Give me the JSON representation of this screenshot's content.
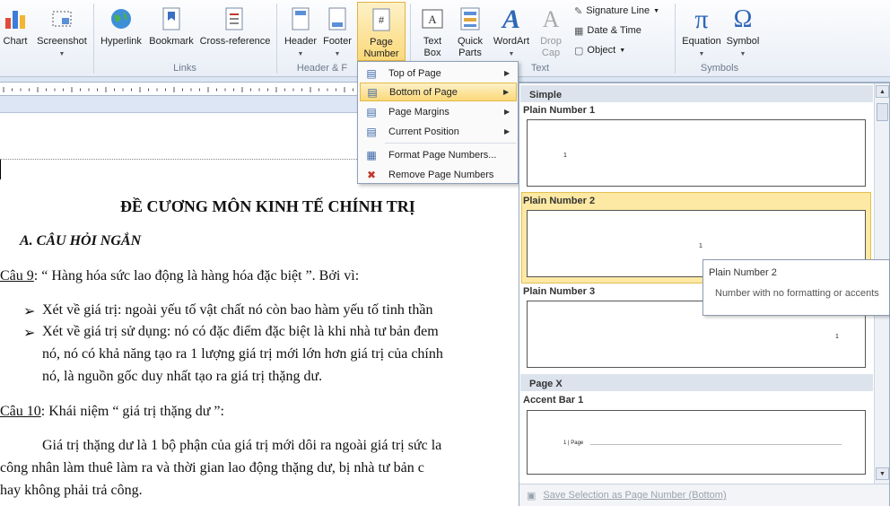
{
  "ribbon": {
    "chart": "Chart",
    "screenshot": "Screenshot",
    "hyperlink": "Hyperlink",
    "bookmark": "Bookmark",
    "crossref": "Cross-reference",
    "header": "Header",
    "footer": "Footer",
    "page_number_1": "Page",
    "page_number_2": "Number",
    "textbox_1": "Text",
    "textbox_2": "Box",
    "quickparts_1": "Quick",
    "quickparts_2": "Parts",
    "wordart": "WordArt",
    "dropcap_1": "Drop",
    "dropcap_2": "Cap",
    "signature": "Signature Line",
    "datetime": "Date & Time",
    "object": "Object",
    "equation": "Equation",
    "symbol": "Symbol",
    "group_links": "Links",
    "group_header": "Header & F",
    "group_text": "Text",
    "group_symbols": "Symbols"
  },
  "menu": {
    "items": [
      "Top of Page",
      "Bottom of Page",
      "Page Margins",
      "Current Position",
      "Format Page Numbers...",
      "Remove Page Numbers"
    ]
  },
  "gallery": {
    "section_simple": "Simple",
    "plain1": "Plain Number 1",
    "plain2": "Plain Number 2",
    "plain3": "Plain Number 3",
    "section_pagex": "Page X",
    "accent1": "Accent Bar 1",
    "thumb_num": "1",
    "accent_text": "1 | Page",
    "footer": "Save Selection as Page Number (Bottom)"
  },
  "tooltip": {
    "title": "Plain Number 2",
    "desc": "Number with no formatting or accents"
  },
  "doc": {
    "title": "ĐỀ CƯƠNG MÔN KINH TẾ CHÍNH TRỊ",
    "section": "A. CÂU HỎI NGẮN",
    "q9_label": "Câu 9",
    "q9_text": ": “ Hàng hóa sức lao động là hàng hóa đặc biệt ”. Bởi vì:",
    "b1": "Xét về giá trị: ngoài yếu tố vật chất nó còn bao hàm yếu tố tinh thần",
    "b2a": "Xét về giá trị sử dụng: nó có đặc điểm đặc biệt là khi nhà tư bản đem",
    "b2b": "nó, nó có khả năng tạo ra 1 lượng giá trị mới lớn hơn giá trị của chính",
    "b2c": "nó, là nguồn gốc duy nhất tạo ra giá trị thặng dư.",
    "q10_label": "Câu 10",
    "q10_text": ": Khái niệm “ giá trị thặng dư ”:",
    "p1": "Giá trị thặng dư là 1 bộ phận của giá trị mới dôi ra ngoài giá trị sức la",
    "p2": "công nhân làm thuê làm ra và thời gian lao động thặng dư, bị nhà tư bản c",
    "p3": "hay không phải trả công."
  },
  "colors": {
    "accent": "#fbd97a",
    "ribbon": "#e9eef6"
  }
}
